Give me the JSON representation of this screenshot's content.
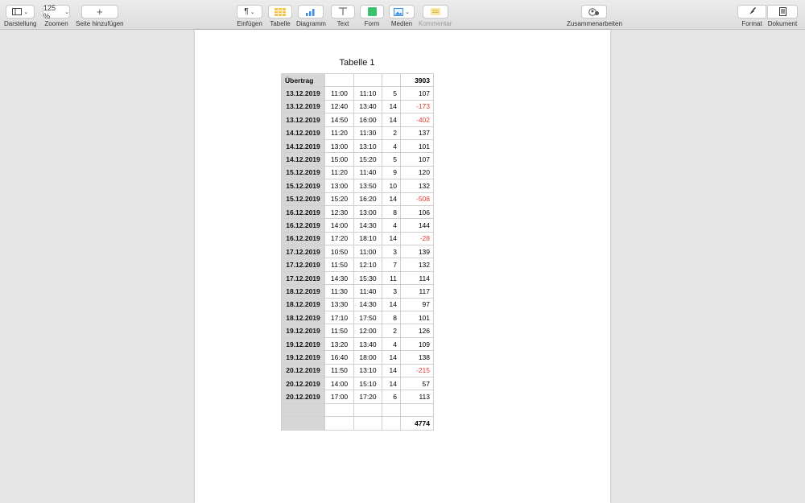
{
  "toolbar": {
    "left": [
      {
        "label": "Darstellung",
        "icon": "sidebar-icon"
      },
      {
        "label": "Zoomen",
        "value": "125 %"
      },
      {
        "label": "Seite hinzufügen",
        "icon": "plus-icon"
      }
    ],
    "center": [
      {
        "label": "Einfügen",
        "icon": "paragraph-icon"
      },
      {
        "label": "Tabelle",
        "icon": "table-icon"
      },
      {
        "label": "Diagramm",
        "icon": "chart-icon"
      },
      {
        "label": "Text",
        "icon": "text-icon"
      },
      {
        "label": "Form",
        "icon": "shape-icon"
      },
      {
        "label": "Medien",
        "icon": "media-icon"
      },
      {
        "label": "Kommentar",
        "icon": "comment-icon"
      }
    ],
    "collaborate": {
      "label": "Zusammenarbeiten",
      "icon": "collaborate-icon"
    },
    "right": [
      {
        "label": "Format",
        "icon": "brush-icon"
      },
      {
        "label": "Dokument",
        "icon": "document-icon"
      }
    ]
  },
  "table": {
    "title": "Tabelle 1",
    "carry": {
      "label": "Übertrag",
      "value": "3903"
    },
    "rows": [
      [
        "13.12.2019",
        "11:00",
        "11:10",
        "5",
        "107"
      ],
      [
        "13.12.2019",
        "12:40",
        "13:40",
        "14",
        "-173"
      ],
      [
        "13.12.2019",
        "14:50",
        "16:00",
        "14",
        "-402"
      ],
      [
        "14.12.2019",
        "11:20",
        "11:30",
        "2",
        "137"
      ],
      [
        "14.12.2019",
        "13:00",
        "13:10",
        "4",
        "101"
      ],
      [
        "14.12.2019",
        "15:00",
        "15:20",
        "5",
        "107"
      ],
      [
        "15.12.2019",
        "11:20",
        "11:40",
        "9",
        "120"
      ],
      [
        "15.12.2019",
        "13:00",
        "13:50",
        "10",
        "132"
      ],
      [
        "15.12.2019",
        "15:20",
        "16:20",
        "14",
        "-508"
      ],
      [
        "16.12.2019",
        "12:30",
        "13:00",
        "8",
        "106"
      ],
      [
        "16.12.2019",
        "14:00",
        "14:30",
        "4",
        "144"
      ],
      [
        "16.12.2019",
        "17:20",
        "18:10",
        "14",
        "-28"
      ],
      [
        "17.12.2019",
        "10:50",
        "11:00",
        "3",
        "139"
      ],
      [
        "17.12.2019",
        "11:50",
        "12:10",
        "7",
        "132"
      ],
      [
        "17.12.2019",
        "14:30",
        "15:30",
        "11",
        "114"
      ],
      [
        "18.12.2019",
        "11:30",
        "11:40",
        "3",
        "117"
      ],
      [
        "18.12.2019",
        "13:30",
        "14:30",
        "14",
        "97"
      ],
      [
        "18.12.2019",
        "17:10",
        "17:50",
        "8",
        "101"
      ],
      [
        "19.12.2019",
        "11:50",
        "12:00",
        "2",
        "126"
      ],
      [
        "19.12.2019",
        "13:20",
        "13:40",
        "4",
        "109"
      ],
      [
        "19.12.2019",
        "16:40",
        "18:00",
        "14",
        "138"
      ],
      [
        "20.12.2019",
        "11:50",
        "13:10",
        "14",
        "-215"
      ],
      [
        "20.12.2019",
        "14:00",
        "15:10",
        "14",
        "57"
      ],
      [
        "20.12.2019",
        "17:00",
        "17:20",
        "6",
        "113"
      ]
    ],
    "total": "4774",
    "negative_color": "#e23b2e"
  }
}
